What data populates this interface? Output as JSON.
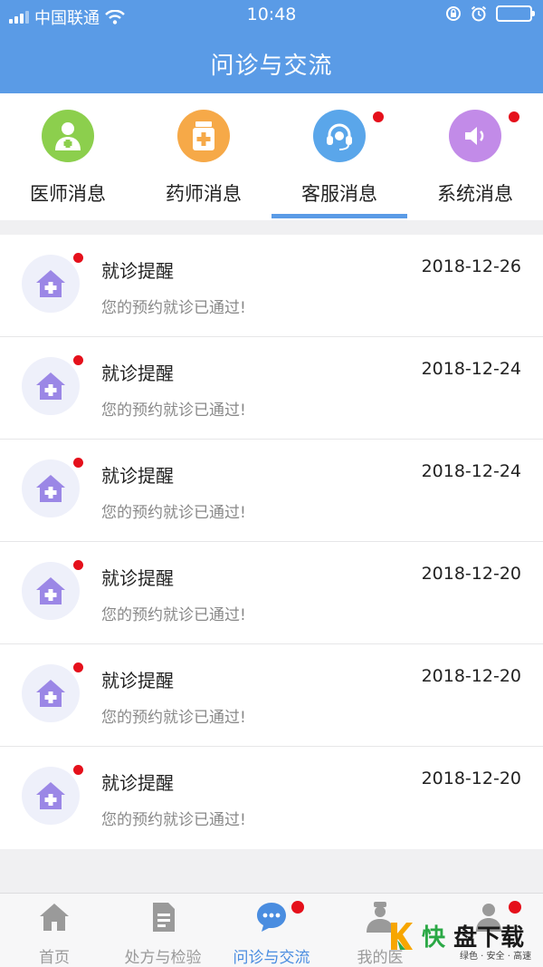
{
  "status_bar": {
    "carrier": "中国联通",
    "time": "10:48"
  },
  "nav": {
    "title": "问诊与交流"
  },
  "categories": [
    {
      "label": "医师消息",
      "icon": "doctor-icon",
      "color": "#8ccf4d",
      "badge": false
    },
    {
      "label": "药师消息",
      "icon": "medicine-icon",
      "color": "#f6a948",
      "badge": false
    },
    {
      "label": "客服消息",
      "icon": "headset-icon",
      "color": "#5aa6ea",
      "badge": true,
      "selected": true
    },
    {
      "label": "系统消息",
      "icon": "speaker-icon",
      "color": "#c28be8",
      "badge": true
    }
  ],
  "messages": [
    {
      "title": "就诊提醒",
      "date": "2018-12-26",
      "body": "您的预约就诊已通过!",
      "unread": true
    },
    {
      "title": "就诊提醒",
      "date": "2018-12-24",
      "body": "您的预约就诊已通过!",
      "unread": true
    },
    {
      "title": "就诊提醒",
      "date": "2018-12-24",
      "body": "您的预约就诊已通过!",
      "unread": true
    },
    {
      "title": "就诊提醒",
      "date": "2018-12-20",
      "body": "您的预约就诊已通过!",
      "unread": true
    },
    {
      "title": "就诊提醒",
      "date": "2018-12-20",
      "body": "您的预约就诊已通过!",
      "unread": true
    },
    {
      "title": "就诊提醒",
      "date": "2018-12-20",
      "body": "您的预约就诊已通过!",
      "unread": true
    }
  ],
  "tabbar": [
    {
      "label": "首页",
      "icon": "home-icon",
      "active": false
    },
    {
      "label": "处方与检验",
      "icon": "prescription-icon",
      "active": false
    },
    {
      "label": "问诊与交流",
      "icon": "chat-icon",
      "active": true,
      "badge": true
    },
    {
      "label": "我的医",
      "icon": "doctor-profile-icon",
      "active": false
    },
    {
      "label": "",
      "icon": "user-icon",
      "active": false,
      "badge": true
    }
  ],
  "watermark": {
    "brand_a": "快",
    "brand_b": "盘下载",
    "tagline": "绿色 · 安全 · 高速"
  },
  "colors": {
    "header": "#5a9be6",
    "accent": "#4a8de0",
    "badge": "#e5101b"
  }
}
